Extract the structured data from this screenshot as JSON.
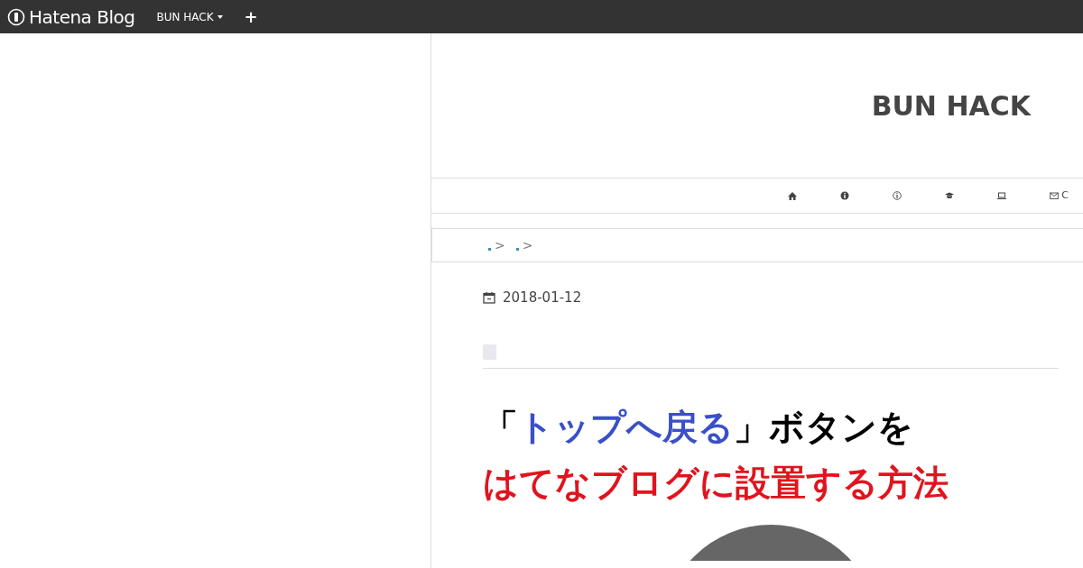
{
  "navbar": {
    "logo": "Hatena Blog",
    "blog_menu": "BUN HACK",
    "add": "+"
  },
  "header": {
    "title": "BUN HACK"
  },
  "nav_items": [
    {
      "kind": "home"
    },
    {
      "kind": "info"
    },
    {
      "kind": "info-outline"
    },
    {
      "kind": "cap"
    },
    {
      "kind": "laptop"
    },
    {
      "kind": "mail",
      "label": "C"
    }
  ],
  "breadcrumb": [
    {
      "separator": ">"
    },
    {
      "separator": ">"
    }
  ],
  "entry": {
    "date": "2018-01-12",
    "title_lines": [
      [
        {
          "text": "「",
          "color": "#000000"
        },
        {
          "text": "トップへ戻る",
          "color": "#3a4fc8"
        },
        {
          "text": "」ボタンを",
          "color": "#000000"
        }
      ],
      [
        {
          "text": "はてなブログに設置する方法",
          "color": "#e0141e"
        }
      ]
    ]
  }
}
